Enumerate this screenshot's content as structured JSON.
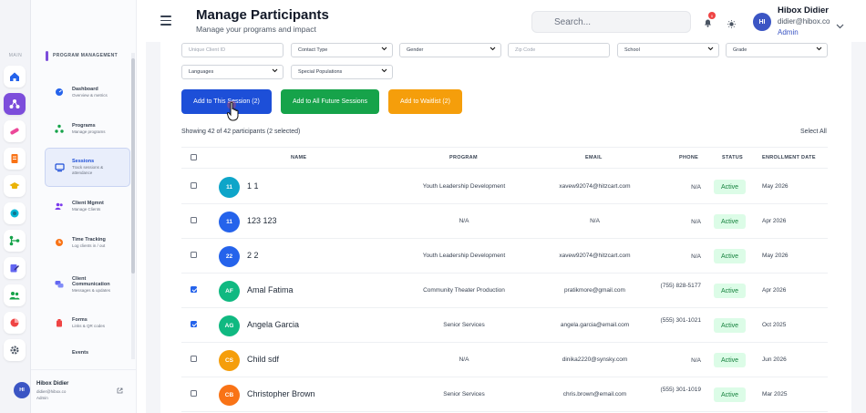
{
  "header": {
    "title": "Manage Participants",
    "subtitle": "Manage your programs and impact",
    "search_placeholder": "Search...",
    "notification_count": "0",
    "user": {
      "initials": "HI",
      "name": "Hibox Didier",
      "email": "didier@hibox.co",
      "role": "Admin"
    }
  },
  "rail": {
    "main_label": "MAIN"
  },
  "sidebar": {
    "section_label": "PROGRAM MANAGEMENT",
    "items": [
      {
        "label": "Dashboard",
        "sub": "Overview & metrics",
        "icon": "dashboard-icon"
      },
      {
        "label": "Programs",
        "sub": "Manage programs",
        "icon": "programs-icon"
      },
      {
        "label": "Sessions",
        "sub": "Track sessions & attendance",
        "icon": "sessions-icon",
        "active": true
      },
      {
        "label": "Client Mgmnt",
        "sub": "Manage Clients",
        "icon": "clients-icon"
      },
      {
        "label": "Time Tracking",
        "sub": "Log clients in / out",
        "icon": "clock-icon"
      },
      {
        "label": "Client Communication",
        "sub": "Messages & updates",
        "icon": "chat-icon"
      },
      {
        "label": "Forms",
        "sub": "Links & QR codes",
        "icon": "forms-icon"
      },
      {
        "label": "Events",
        "sub": "",
        "icon": "events-icon"
      }
    ],
    "user": {
      "initials": "HI",
      "name": "Hibox Didier",
      "email": "didier@hibox.co",
      "role": "Admin"
    }
  },
  "filters": {
    "unique_client_id_placeholder": "Unique Client ID",
    "contact_type": "Contact Type",
    "gender": "Gender",
    "zip_code_placeholder": "Zip Code",
    "school": "School",
    "grade": "Grade",
    "languages": "Languages",
    "special_populations": "Special Populations"
  },
  "actions": {
    "add_session": "Add to This Session (2)",
    "add_future": "Add to All Future Sessions",
    "add_waitlist": "Add to Waitlist (2)"
  },
  "summary": {
    "showing": "Showing 42 of 42 participants (2 selected)",
    "select_all": "Select All"
  },
  "table": {
    "columns": {
      "name": "NAME",
      "program": "PROGRAM",
      "email": "EMAIL",
      "phone": "PHONE",
      "status": "STATUS",
      "enrollment": "ENROLLMENT DATE"
    },
    "rows": [
      {
        "initials": "11",
        "name": "1 1",
        "program": "Youth Leadership Development",
        "email": "xavew92074@hitzcart.com",
        "phone": "N/A",
        "status": "Active",
        "date": "May 2026",
        "checked": false,
        "color": "#0ea5c9"
      },
      {
        "initials": "11",
        "name": "123 123",
        "program": "N/A",
        "email": "N/A",
        "phone": "N/A",
        "status": "Active",
        "date": "Apr 2026",
        "checked": false,
        "color": "#2563eb"
      },
      {
        "initials": "22",
        "name": "2 2",
        "program": "Youth Leadership Development",
        "email": "xavew92074@hitzcart.com",
        "phone": "N/A",
        "status": "Active",
        "date": "May 2026",
        "checked": false,
        "color": "#2563eb"
      },
      {
        "initials": "AF",
        "name": "Amal Fatima",
        "program": "Community Theater Production",
        "email": "pratikmore@gmail.com",
        "phone": "(755) 828-5177",
        "status": "Active",
        "date": "Apr 2026",
        "checked": true,
        "color": "#10b981"
      },
      {
        "initials": "AG",
        "name": "Angela Garcia",
        "program": "Senior Services",
        "email": "angela.garcia@email.com",
        "phone": "(555) 301-1021",
        "status": "Active",
        "date": "Oct 2025",
        "checked": true,
        "color": "#10b981"
      },
      {
        "initials": "CS",
        "name": "Child sdf",
        "program": "N/A",
        "email": "dinika2220@synsky.com",
        "phone": "N/A",
        "status": "Active",
        "date": "Jun 2026",
        "checked": false,
        "color": "#f59e0b"
      },
      {
        "initials": "CB",
        "name": "Christopher Brown",
        "program": "Senior Services",
        "email": "chris.brown@email.com",
        "phone": "(555) 301-1019",
        "status": "Active",
        "date": "Mar 2025",
        "checked": false,
        "color": "#f97316"
      }
    ]
  },
  "colors": {
    "accent": "#7c4ddb",
    "primary": "#1d4fd8",
    "success": "#16a34a",
    "warning": "#f59e0b"
  }
}
